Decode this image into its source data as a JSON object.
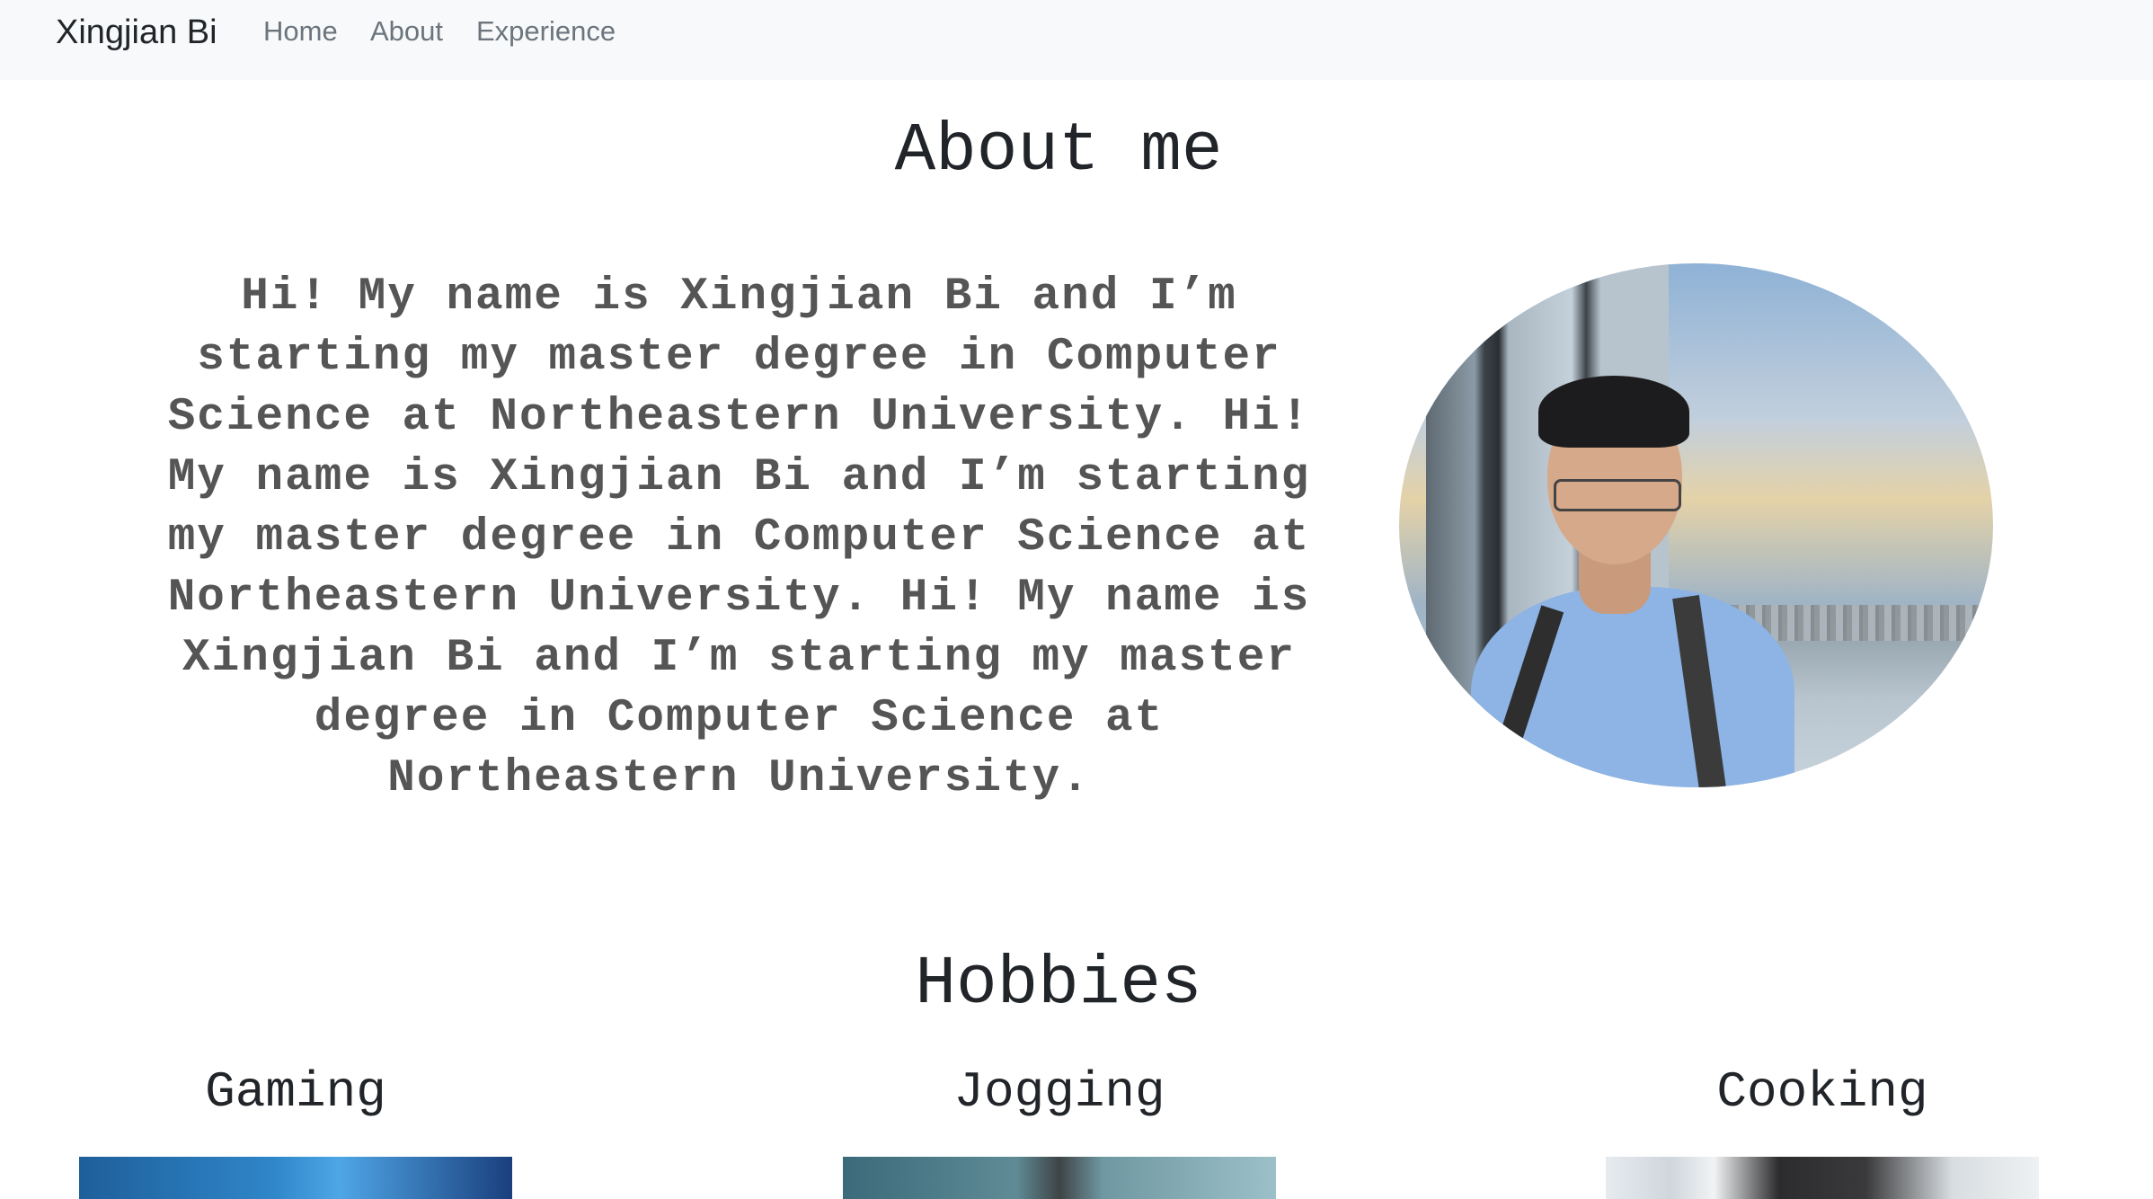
{
  "navbar": {
    "brand": "Xingjian Bi",
    "links": [
      {
        "label": "Home"
      },
      {
        "label": "About"
      },
      {
        "label": "Experience"
      }
    ]
  },
  "about": {
    "title": "About me",
    "bio": "Hi! My name is Xingjian Bi and I’m starting my master degree in Computer Science at Northeastern University. Hi! My name is Xingjian Bi and I’m starting my master degree in Computer Science at Northeastern University. Hi! My name is Xingjian Bi and I’m starting my master degree in Computer Science at Northeastern University."
  },
  "hobbies": {
    "title": "Hobbies",
    "items": [
      {
        "name": "Gaming"
      },
      {
        "name": "Jogging"
      },
      {
        "name": "Cooking"
      }
    ]
  },
  "colors": {
    "navbar_bg": "#f8f9fa",
    "brand_text": "#212529",
    "nav_link": "#6c757d",
    "bio_text": "#555555"
  }
}
